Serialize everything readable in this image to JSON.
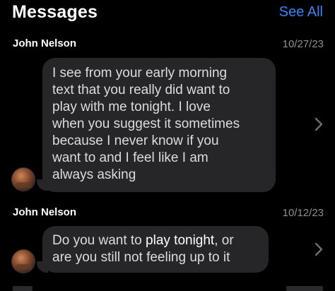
{
  "header": {
    "title": "Messages",
    "see_all_label": "See All"
  },
  "messages": [
    {
      "sender": "John Nelson",
      "date": "10/27/23",
      "lines": [
        "I see from your early morning",
        "text that you really did want to",
        "play with me tonight. I love",
        "when you suggest it sometimes",
        "because I never know if you",
        "want to and I feel like I am",
        "always asking"
      ]
    },
    {
      "sender": "John Nelson",
      "date": "10/12/23",
      "line1_pre": "Do you want to ",
      "line1_highlight": "play tonight",
      "line1_post": ", or",
      "line2": "are you still not feeling up to it"
    }
  ],
  "icons": {
    "chevron": "chevron-right-icon",
    "avatar": "contact-avatar"
  },
  "colors": {
    "background": "#000000",
    "bubble": "#262628",
    "accent": "#3b82f6",
    "secondary_text": "#8e8e93"
  }
}
